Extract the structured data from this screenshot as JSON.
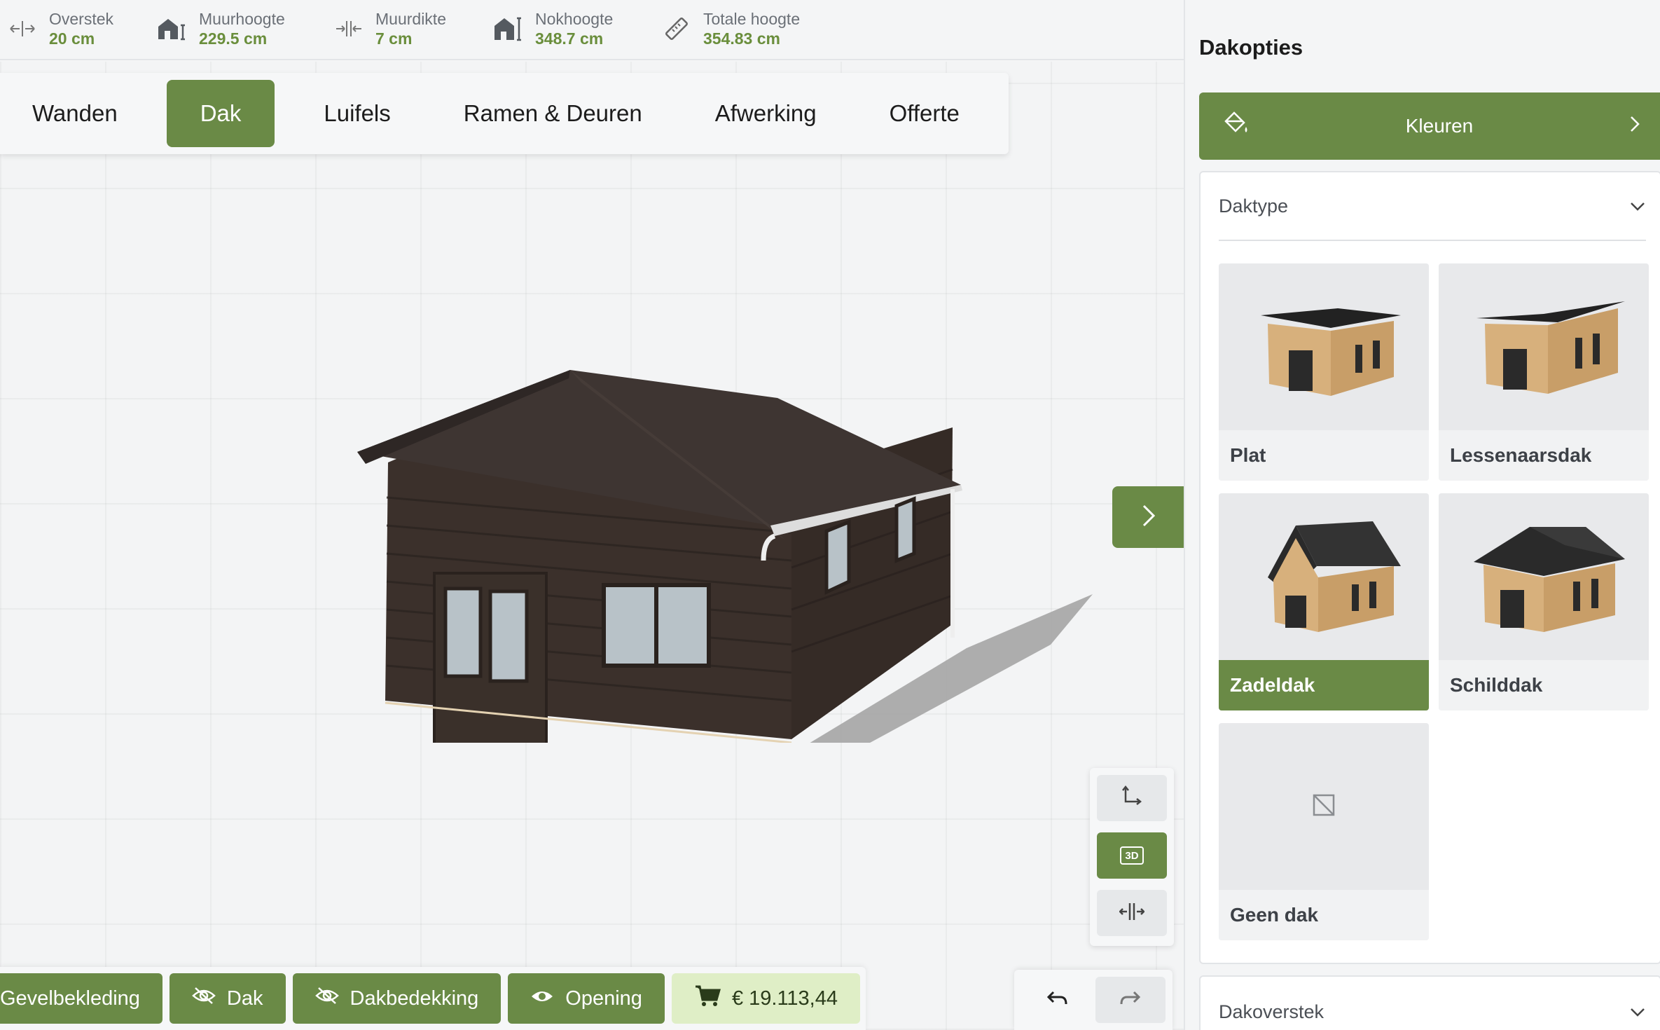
{
  "metrics": [
    {
      "label": "Overstek",
      "value": "20 cm",
      "icon": "overhang-arrows-icon"
    },
    {
      "label": "Muurhoogte",
      "value": "229.5 cm",
      "icon": "wall-height-icon"
    },
    {
      "label": "Muurdikte",
      "value": "7 cm",
      "icon": "wall-thickness-icon"
    },
    {
      "label": "Nokhoogte",
      "value": "348.7 cm",
      "icon": "ridge-height-icon"
    },
    {
      "label": "Totale hoogte",
      "value": "354.83 cm",
      "icon": "ruler-icon"
    }
  ],
  "tabs": [
    {
      "label": "Wanden",
      "active": false
    },
    {
      "label": "Dak",
      "active": true
    },
    {
      "label": "Luifels",
      "active": false
    },
    {
      "label": "Ramen & Deuren",
      "active": false
    },
    {
      "label": "Afwerking",
      "active": false
    },
    {
      "label": "Offerte",
      "active": false
    }
  ],
  "view_controls": {
    "mode_label": "3D"
  },
  "toggles": [
    {
      "label": "Gevelbekleding",
      "icon": "none"
    },
    {
      "label": "Dak",
      "icon": "eye-off-icon"
    },
    {
      "label": "Dakbedekking",
      "icon": "eye-off-icon"
    },
    {
      "label": "Opening",
      "icon": "eye-icon"
    }
  ],
  "price": "€ 19.113,44",
  "panel": {
    "title": "Dakopties",
    "colors_label": "Kleuren",
    "daktype_label": "Daktype",
    "overstek_label": "Dakoverstek",
    "roof_types": [
      {
        "label": "Plat",
        "selected": false
      },
      {
        "label": "Lessenaarsdak",
        "selected": false
      },
      {
        "label": "Zadeldak",
        "selected": true
      },
      {
        "label": "Schilddak",
        "selected": false
      },
      {
        "label": "Geen dak",
        "selected": false
      }
    ]
  },
  "colors": {
    "accent": "#6a8a46",
    "value_green": "#6a8e3c",
    "price_bg": "#dfeec6",
    "wood_dark": "#3b302b",
    "roof_dark": "#3e3532"
  }
}
